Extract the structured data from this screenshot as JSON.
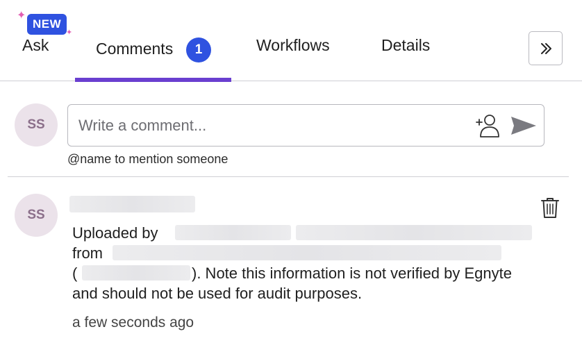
{
  "tabs": {
    "ask": {
      "label": "Ask",
      "badge": "NEW"
    },
    "comments": {
      "label": "Comments",
      "count": "1"
    },
    "workflows": {
      "label": "Workflows"
    },
    "details": {
      "label": "Details"
    },
    "active": "comments"
  },
  "composer": {
    "avatar_initials": "SS",
    "placeholder": "Write a comment...",
    "value": "",
    "hint": "@name to mention someone"
  },
  "comment": {
    "avatar_initials": "SS",
    "line1_prefix": "Uploaded by",
    "line2_prefix": "from",
    "line3_open": "(",
    "line3_suffix": "). Note this information is not verified by Egnyte",
    "line4": "and should not be used for audit purposes.",
    "timestamp": "a few seconds ago"
  },
  "icons": {
    "sparkle": "sparkle-icon",
    "expand": "double-chevron-right-icon",
    "add_user": "add-user-icon",
    "send": "send-icon",
    "delete": "trash-icon"
  },
  "colors": {
    "accent_blue": "#2f52e0",
    "active_underline": "#6a3fd0",
    "sparkle_pink": "#e25fb3",
    "avatar_bg": "#ebe2ea",
    "avatar_text": "#8b6f8a"
  }
}
